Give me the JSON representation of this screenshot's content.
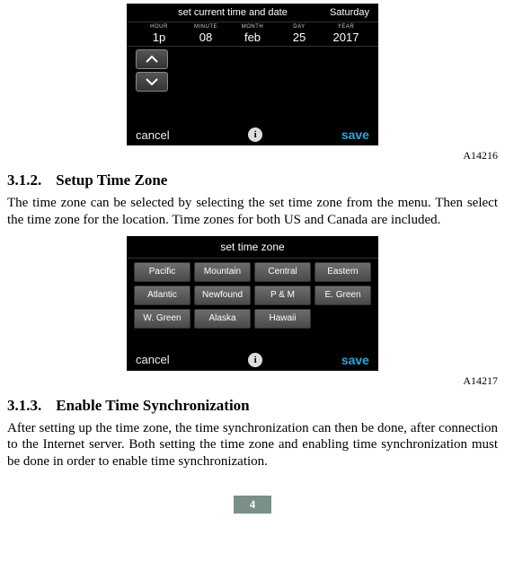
{
  "figure1": {
    "id": "A14216",
    "header_title": "set current time and date",
    "day_value": "Saturday",
    "columns": [
      {
        "label": "HOUR",
        "value": "1p"
      },
      {
        "label": "MINUTE",
        "value": "08"
      },
      {
        "label": "MONTH",
        "value": "feb"
      },
      {
        "label": "DAY",
        "value": "25"
      },
      {
        "label": "YEAR",
        "value": "2017"
      }
    ],
    "cancel": "cancel",
    "save": "save",
    "info": "i"
  },
  "section1": {
    "num": "3.1.2.",
    "title": "Setup Time Zone",
    "paragraph": "The time zone can be selected by selecting the set time zone from the menu. Then select the time zone for the location. Time zones for both US and Canada are included."
  },
  "figure2": {
    "id": "A14217",
    "header_title": "set time zone",
    "zones": [
      "Pacific",
      "Mountain",
      "Central",
      "Eastern",
      "Atlantic",
      "Newfound",
      "P & M",
      "E. Green",
      "W. Green",
      "Alaska",
      "Hawaii"
    ],
    "cancel": "cancel",
    "save": "save",
    "info": "i"
  },
  "section2": {
    "num": "3.1.3.",
    "title": "Enable Time Synchronization",
    "paragraph": "After setting up the time zone, the time synchronization can then be done, after connection to the Internet server. Both setting the time zone and enabling time synchronization must be done in order to enable time synchronization."
  },
  "page_number": "4"
}
